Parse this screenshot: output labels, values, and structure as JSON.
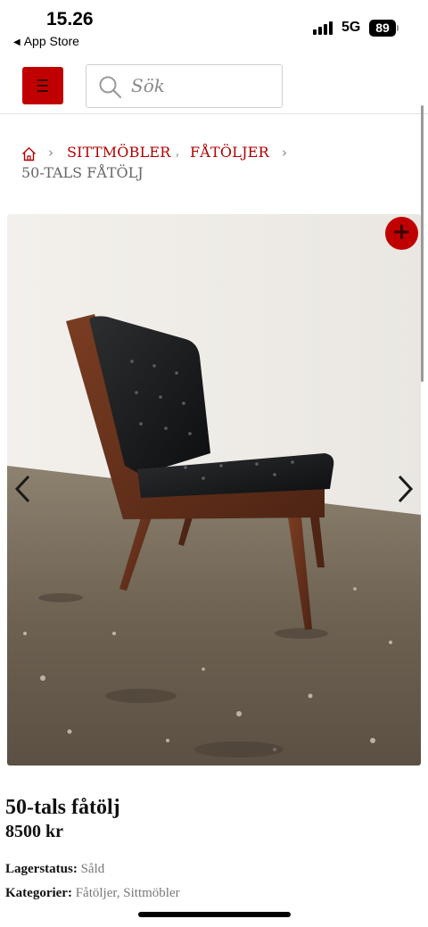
{
  "status_bar": {
    "time": "15.26",
    "back_app": "App Store",
    "network": "5G",
    "battery": "89"
  },
  "header": {
    "menu_icon": "hamburger-icon",
    "search_placeholder": "Sök",
    "search_icon": "search-icon",
    "accent_color": "#c00000"
  },
  "breadcrumb": {
    "home_icon": "home-icon",
    "items": [
      "SITTMÖBLER",
      "FÅTÖLJER"
    ],
    "current": "50-TALS FÅTÖLJ"
  },
  "gallery": {
    "prev_icon": "chevron-left-icon",
    "next_icon": "chevron-right-icon",
    "zoom_icon": "plus-icon"
  },
  "product": {
    "title": "50-tals fåtölj",
    "price": "8500 kr",
    "stock_label": "Lagerstatus:",
    "stock_value": "Såld",
    "categories_label": "Kategorier:",
    "categories": [
      "Fåtöljer",
      "Sittmöbler"
    ]
  }
}
